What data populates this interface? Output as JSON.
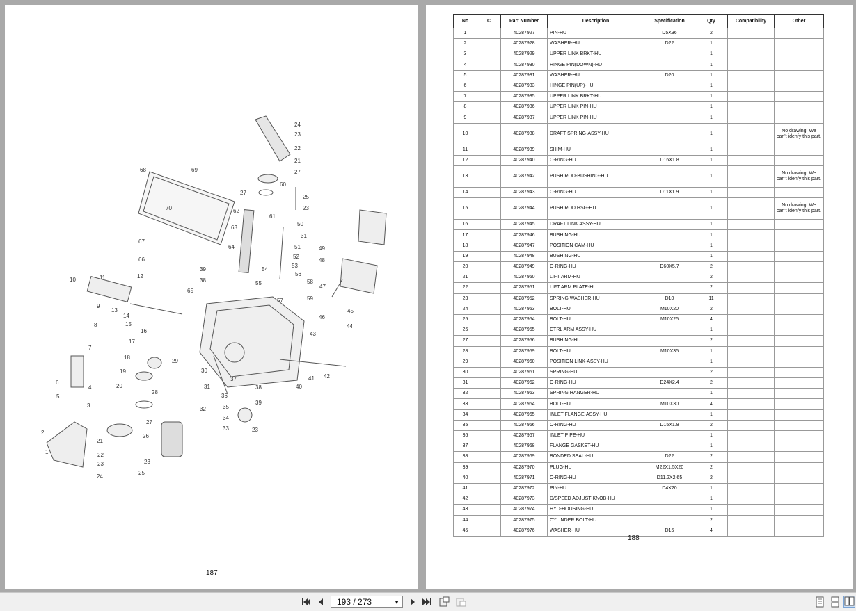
{
  "viewer": {
    "page_indicator": "193 / 273",
    "icons": {
      "first_page": "first-page-icon",
      "prev_page": "previous-page-icon",
      "next_page": "next-page-icon",
      "last_page": "last-page-icon",
      "fit": "fit-page-icon",
      "rotate": "rotate-icon",
      "single": "single-page-view-icon",
      "continuous": "continuous-view-icon",
      "two_page": "two-page-view-icon"
    }
  },
  "left_page": {
    "page_number": "187",
    "callouts": [
      "1",
      "2",
      "3",
      "4",
      "5",
      "6",
      "7",
      "8",
      "9",
      "10",
      "11",
      "12",
      "13",
      "14",
      "15",
      "16",
      "17",
      "18",
      "19",
      "20",
      "21",
      "22",
      "23",
      "24",
      "25",
      "26",
      "27",
      "28",
      "29",
      "30",
      "31",
      "32",
      "33",
      "34",
      "35",
      "36",
      "37",
      "38",
      "39",
      "40",
      "41",
      "42",
      "43",
      "44",
      "45",
      "46",
      "47",
      "48",
      "49",
      "50",
      "51",
      "52",
      "53",
      "54",
      "55",
      "56",
      "57",
      "58",
      "59",
      "60",
      "61",
      "62",
      "63",
      "64",
      "65",
      "66",
      "67",
      "68",
      "69",
      "70"
    ]
  },
  "right_page": {
    "page_number": "188",
    "columns": [
      "No",
      "C",
      "Part Number",
      "Description",
      "Specification",
      "Qty",
      "Compatibility",
      "Other"
    ],
    "rows": [
      {
        "no": "1",
        "c": "",
        "part": "40287927",
        "desc": "PIN-HU",
        "spec": "D5X36",
        "qty": "2",
        "compat": "",
        "other": ""
      },
      {
        "no": "2",
        "c": "",
        "part": "40287928",
        "desc": "WASHER-HU",
        "spec": "D22",
        "qty": "1",
        "compat": "",
        "other": ""
      },
      {
        "no": "3",
        "c": "",
        "part": "40287929",
        "desc": "UPPER LINK BRKT-HU",
        "spec": "",
        "qty": "1",
        "compat": "",
        "other": ""
      },
      {
        "no": "4",
        "c": "",
        "part": "40287930",
        "desc": "HINGE PIN(DOWN)-HU",
        "spec": "",
        "qty": "1",
        "compat": "",
        "other": ""
      },
      {
        "no": "5",
        "c": "",
        "part": "40287931",
        "desc": "WASHER-HU",
        "spec": "D20",
        "qty": "1",
        "compat": "",
        "other": ""
      },
      {
        "no": "6",
        "c": "",
        "part": "40287933",
        "desc": "HINGE PIN(UP)-HU",
        "spec": "",
        "qty": "1",
        "compat": "",
        "other": ""
      },
      {
        "no": "7",
        "c": "",
        "part": "40287935",
        "desc": "UPPER LINK BRKT-HU",
        "spec": "",
        "qty": "1",
        "compat": "",
        "other": ""
      },
      {
        "no": "8",
        "c": "",
        "part": "40287936",
        "desc": "UPPER LINK PIN-HU",
        "spec": "",
        "qty": "1",
        "compat": "",
        "other": ""
      },
      {
        "no": "9",
        "c": "",
        "part": "40287937",
        "desc": "UPPER LINK PIN-HU",
        "spec": "",
        "qty": "1",
        "compat": "",
        "other": ""
      },
      {
        "no": "10",
        "c": "",
        "part": "40287938",
        "desc": "DRAFT SPRING-ASSY-HU",
        "spec": "",
        "qty": "1",
        "compat": "",
        "other": "No drawing. We can't idenfy this part."
      },
      {
        "no": "11",
        "c": "",
        "part": "40287939",
        "desc": "SHIM-HU",
        "spec": "",
        "qty": "1",
        "compat": "",
        "other": ""
      },
      {
        "no": "12",
        "c": "",
        "part": "40287940",
        "desc": "O-RING-HU",
        "spec": "D16X1.8",
        "qty": "1",
        "compat": "",
        "other": ""
      },
      {
        "no": "13",
        "c": "",
        "part": "40287942",
        "desc": "PUSH ROD-BUSHING-HU",
        "spec": "",
        "qty": "1",
        "compat": "",
        "other": "No drawing. We can't idenfy this part."
      },
      {
        "no": "14",
        "c": "",
        "part": "40287943",
        "desc": "O-RING-HU",
        "spec": "D11X1.9",
        "qty": "1",
        "compat": "",
        "other": ""
      },
      {
        "no": "15",
        "c": "",
        "part": "40287944",
        "desc": "PUSH ROD HSG-HU",
        "spec": "",
        "qty": "1",
        "compat": "",
        "other": "No drawing. We can't idenfy this part."
      },
      {
        "no": "16",
        "c": "",
        "part": "40287945",
        "desc": "DRAFT LINK ASSY-HU",
        "spec": "",
        "qty": "1",
        "compat": "",
        "other": ""
      },
      {
        "no": "17",
        "c": "",
        "part": "40287946",
        "desc": "BUSHING-HU",
        "spec": "",
        "qty": "1",
        "compat": "",
        "other": ""
      },
      {
        "no": "18",
        "c": "",
        "part": "40287947",
        "desc": "POSITION CAM-HU",
        "spec": "",
        "qty": "1",
        "compat": "",
        "other": ""
      },
      {
        "no": "19",
        "c": "",
        "part": "40287948",
        "desc": "BUSHING-HU",
        "spec": "",
        "qty": "1",
        "compat": "",
        "other": ""
      },
      {
        "no": "20",
        "c": "",
        "part": "40287949",
        "desc": "O-RING-HU",
        "spec": "D60X5.7",
        "qty": "2",
        "compat": "",
        "other": ""
      },
      {
        "no": "21",
        "c": "",
        "part": "40287950",
        "desc": "LIFT ARM-HU",
        "spec": "",
        "qty": "2",
        "compat": "",
        "other": ""
      },
      {
        "no": "22",
        "c": "",
        "part": "40287951",
        "desc": "LIFT ARM PLATE-HU",
        "spec": "",
        "qty": "2",
        "compat": "",
        "other": ""
      },
      {
        "no": "23",
        "c": "",
        "part": "40287952",
        "desc": "SPRING WASHER-HU",
        "spec": "D10",
        "qty": "11",
        "compat": "",
        "other": ""
      },
      {
        "no": "24",
        "c": "",
        "part": "40287953",
        "desc": "BOLT-HU",
        "spec": "M10X20",
        "qty": "2",
        "compat": "",
        "other": ""
      },
      {
        "no": "25",
        "c": "",
        "part": "40287954",
        "desc": "BOLT-HU",
        "spec": "M10X25",
        "qty": "4",
        "compat": "",
        "other": ""
      },
      {
        "no": "26",
        "c": "",
        "part": "40287955",
        "desc": "CTRL ARM ASSY-HU",
        "spec": "",
        "qty": "1",
        "compat": "",
        "other": ""
      },
      {
        "no": "27",
        "c": "",
        "part": "40287956",
        "desc": "BUSHING-HU",
        "spec": "",
        "qty": "2",
        "compat": "",
        "other": ""
      },
      {
        "no": "28",
        "c": "",
        "part": "40287959",
        "desc": "BOLT-HU",
        "spec": "M10X35",
        "qty": "1",
        "compat": "",
        "other": ""
      },
      {
        "no": "29",
        "c": "",
        "part": "40287960",
        "desc": "POSITION LINK-ASSY-HU",
        "spec": "",
        "qty": "1",
        "compat": "",
        "other": ""
      },
      {
        "no": "30",
        "c": "",
        "part": "40287961",
        "desc": "SPRING-HU",
        "spec": "",
        "qty": "2",
        "compat": "",
        "other": ""
      },
      {
        "no": "31",
        "c": "",
        "part": "40287962",
        "desc": "O-RING-HU",
        "spec": "D24X2.4",
        "qty": "2",
        "compat": "",
        "other": ""
      },
      {
        "no": "32",
        "c": "",
        "part": "40287963",
        "desc": "SPRING HANGER-HU",
        "spec": "",
        "qty": "1",
        "compat": "",
        "other": ""
      },
      {
        "no": "33",
        "c": "",
        "part": "40287964",
        "desc": "BOLT-HU",
        "spec": "M10X30",
        "qty": "4",
        "compat": "",
        "other": ""
      },
      {
        "no": "34",
        "c": "",
        "part": "40287965",
        "desc": "INLET FLANGE-ASSY-HU",
        "spec": "",
        "qty": "1",
        "compat": "",
        "other": ""
      },
      {
        "no": "35",
        "c": "",
        "part": "40287966",
        "desc": "O-RING-HU",
        "spec": "D15X1.8",
        "qty": "2",
        "compat": "",
        "other": ""
      },
      {
        "no": "36",
        "c": "",
        "part": "40287967",
        "desc": "INLET PIPE-HU",
        "spec": "",
        "qty": "1",
        "compat": "",
        "other": ""
      },
      {
        "no": "37",
        "c": "",
        "part": "40287968",
        "desc": "FLANGE GASKET-HU",
        "spec": "",
        "qty": "1",
        "compat": "",
        "other": ""
      },
      {
        "no": "38",
        "c": "",
        "part": "40287969",
        "desc": "BONDED SEAL-HU",
        "spec": "D22",
        "qty": "2",
        "compat": "",
        "other": ""
      },
      {
        "no": "39",
        "c": "",
        "part": "40287970",
        "desc": "PLUG-HU",
        "spec": "M22X1.5X20",
        "qty": "2",
        "compat": "",
        "other": ""
      },
      {
        "no": "40",
        "c": "",
        "part": "40287971",
        "desc": "O-RING-HU",
        "spec": "D11.2X2.65",
        "qty": "2",
        "compat": "",
        "other": ""
      },
      {
        "no": "41",
        "c": "",
        "part": "40287972",
        "desc": "PIN-HU",
        "spec": "D4X20",
        "qty": "1",
        "compat": "",
        "other": ""
      },
      {
        "no": "42",
        "c": "",
        "part": "40287973",
        "desc": "D/SPEED ADJUST-KNOB-HU",
        "spec": "",
        "qty": "1",
        "compat": "",
        "other": ""
      },
      {
        "no": "43",
        "c": "",
        "part": "40287974",
        "desc": "HYD-HOUSING-HU",
        "spec": "",
        "qty": "1",
        "compat": "",
        "other": ""
      },
      {
        "no": "44",
        "c": "",
        "part": "40287975",
        "desc": "CYLINDER BOLT-HU",
        "spec": "",
        "qty": "2",
        "compat": "",
        "other": ""
      },
      {
        "no": "45",
        "c": "",
        "part": "40287976",
        "desc": "WASHER-HU",
        "spec": "D16",
        "qty": "4",
        "compat": "",
        "other": ""
      }
    ]
  }
}
